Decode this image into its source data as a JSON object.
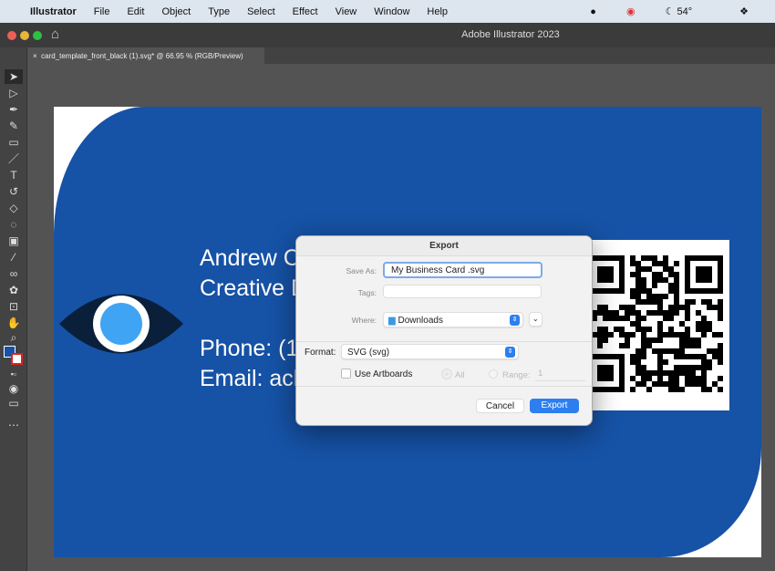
{
  "menubar": {
    "app": "Illustrator",
    "items": [
      "File",
      "Edit",
      "Object",
      "Type",
      "Select",
      "Effect",
      "View",
      "Window",
      "Help"
    ],
    "weather": "54°"
  },
  "window": {
    "title": "Adobe Illustrator 2023"
  },
  "document_tab": {
    "label": "card_template_front_black (1).svg* @ 66.95 % (RGB/Preview)"
  },
  "card": {
    "lines": [
      "Andrew C",
      "Creative D",
      "Phone: (1",
      "Email: ach"
    ],
    "colors": {
      "background": "#1652a6",
      "eye_outer": "#0a1f3a",
      "eye_iris": "#3fa4f4"
    }
  },
  "dialog": {
    "title": "Export",
    "save_as_label": "Save As:",
    "save_as_value": "My Business Card .svg",
    "tags_label": "Tags:",
    "tags_value": "",
    "where_label": "Where:",
    "where_value": "Downloads",
    "format_label": "Format:",
    "format_value": "SVG (svg)",
    "use_artboards_label": "Use Artboards",
    "use_artboards_checked": false,
    "all_label": "All",
    "range_label": "Range:",
    "range_value": "1",
    "cancel_label": "Cancel",
    "export_label": "Export",
    "accent": "#2d7ff0"
  }
}
